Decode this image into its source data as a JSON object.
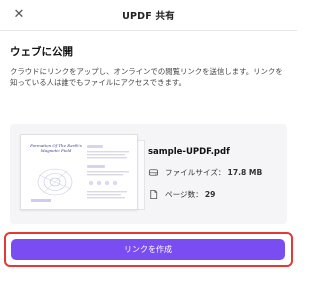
{
  "window": {
    "title": "UPDF 共有",
    "close_glyph": "✕"
  },
  "share": {
    "section_title": "ウェブに公開",
    "description": "クラウドにリンクをアップし、オンラインでの閲覧リンクを送信します。リンクを知っている人は誰でもファイルにアクセスできます。"
  },
  "file": {
    "thumbnail_title": "Formation Of The Earth's Magnetic Field",
    "name": "sample-UPDF.pdf",
    "size_label": "ファイルサイズ：",
    "size_value": "17.8 MB",
    "pages_label": "ページ数：",
    "pages_value": "29",
    "icons": [
      "drive-icon",
      "pages-icon"
    ]
  },
  "actions": {
    "create_link_label": "リンクを作成"
  },
  "colors": {
    "accent": "#7a4df3",
    "highlight": "#e53935"
  }
}
